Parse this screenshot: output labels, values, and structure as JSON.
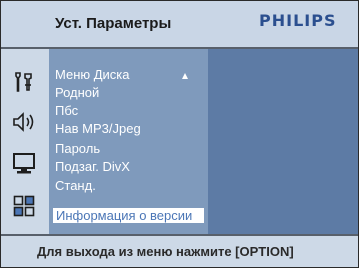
{
  "header": {
    "title": "Уст. Параметры",
    "brand": "PHILIPS"
  },
  "side_icons": [
    "tools-icon",
    "speaker-icon",
    "monitor-icon",
    "grid-icon"
  ],
  "menu": {
    "items": [
      {
        "label": "Меню Диска"
      },
      {
        "label": "Родной"
      },
      {
        "label": "Пбс"
      },
      {
        "label": "Нав MP3/Jpeg"
      },
      {
        "label": "Пароль"
      },
      {
        "label": "Подзаг. DivX"
      },
      {
        "label": "Станд."
      },
      {
        "label": "Информация о версии",
        "selected": true
      }
    ]
  },
  "footer": {
    "hint": "Для выхода из меню нажмите [OPTION]"
  },
  "colors": {
    "menu_panel": "#7f9abc",
    "submenu_panel": "#5d7ba5",
    "background": "#cdd9e7",
    "brand": "#2b4f8f",
    "selected_text": "#4b76b6"
  }
}
